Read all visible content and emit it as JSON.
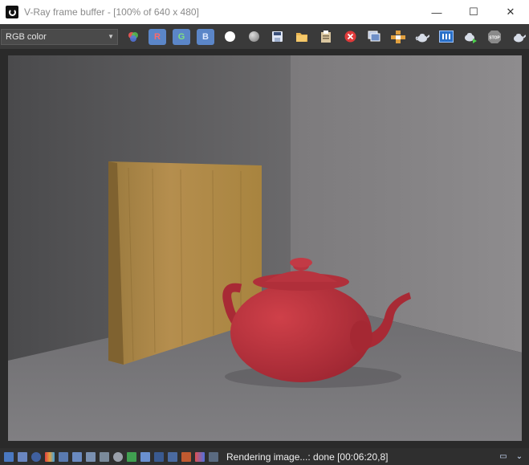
{
  "window": {
    "title": "V-Ray frame buffer - [100% of 640 x 480]",
    "minimize_glyph": "—",
    "maximize_glyph": "☐",
    "close_glyph": "✕"
  },
  "toolbar": {
    "channel_select_value": "RGB color",
    "red_label": "R",
    "green_label": "G",
    "blue_label": "B",
    "icons": [
      "color-channels-icon",
      "red-channel-icon",
      "green-channel-icon",
      "blue-channel-icon",
      "mono-icon",
      "alpha-icon",
      "save-icon",
      "open-icon",
      "clipboard-icon",
      "clear-icon",
      "vfb-history-icon",
      "region-render-icon",
      "teapot-render-icon",
      "render-elements-icon",
      "interactive-render-icon",
      "stop-icon",
      "teapot-icon"
    ]
  },
  "status": {
    "text": "Rendering image...: done [00:06:20,8]"
  },
  "colors": {
    "window_bg": "#2d2d2d",
    "toolbar_bg": "#3a3a3a",
    "accent_blue": "#5b86c8",
    "teapot_red": "#b8323b",
    "wood": "#b08a4a"
  }
}
